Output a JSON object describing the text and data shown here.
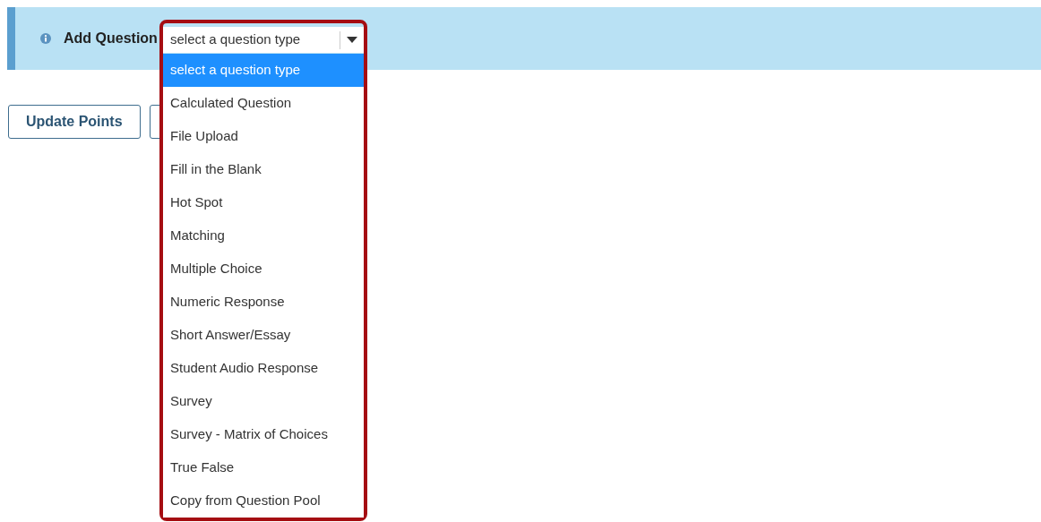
{
  "toolbar": {
    "label": "Add Question",
    "select": {
      "value": "select a question type",
      "expanded": true,
      "options": [
        {
          "label": "select a question type",
          "selected": true
        },
        {
          "label": "Calculated Question",
          "selected": false
        },
        {
          "label": "File Upload",
          "selected": false
        },
        {
          "label": "Fill in the Blank",
          "selected": false
        },
        {
          "label": "Hot Spot",
          "selected": false
        },
        {
          "label": "Matching",
          "selected": false
        },
        {
          "label": "Multiple Choice",
          "selected": false
        },
        {
          "label": "Numeric Response",
          "selected": false
        },
        {
          "label": "Short Answer/Essay",
          "selected": false
        },
        {
          "label": "Student Audio Response",
          "selected": false
        },
        {
          "label": "Survey",
          "selected": false
        },
        {
          "label": "Survey - Matrix of Choices",
          "selected": false
        },
        {
          "label": "True False",
          "selected": false
        },
        {
          "label": "Copy from Question Pool",
          "selected": false
        }
      ]
    }
  },
  "buttons": [
    {
      "kind": "text",
      "label": "Update Points"
    },
    {
      "kind": "covered"
    }
  ]
}
